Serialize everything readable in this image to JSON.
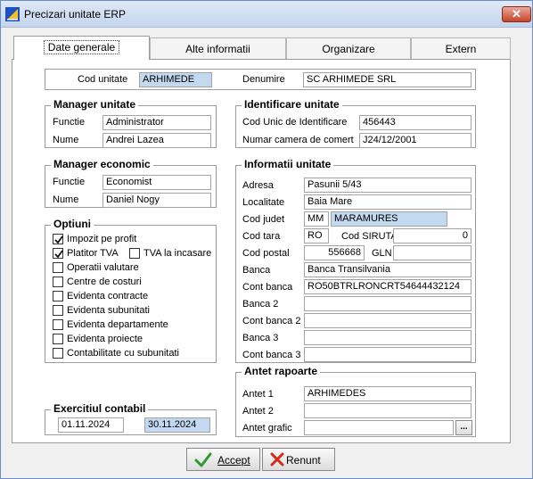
{
  "window": {
    "title": "Precizari unitate ERP",
    "close_label": "✕"
  },
  "tabs": [
    {
      "label": "Date generale"
    },
    {
      "label": "Alte informatii"
    },
    {
      "label": "Organizare"
    },
    {
      "label": "Extern"
    }
  ],
  "header": {
    "cod_unitate_label": "Cod unitate",
    "cod_unitate_value": "ARHIMEDE",
    "denumire_label": "Denumire",
    "denumire_value": "SC ARHIMEDE SRL"
  },
  "manager_unitate": {
    "title": "Manager unitate",
    "functie_label": "Functie",
    "functie_value": "Administrator",
    "nume_label": "Nume",
    "nume_value": "Andrei Lazea"
  },
  "manager_economic": {
    "title": "Manager economic",
    "functie_label": "Functie",
    "functie_value": "Economist",
    "nume_label": "Nume",
    "nume_value": "Daniel Nogy"
  },
  "optiuni": {
    "title": "Optiuni",
    "items": [
      {
        "label": "Impozit pe profit",
        "checked": true
      },
      {
        "label": "Platitor TVA",
        "checked": true
      },
      {
        "label": "TVA la incasare",
        "checked": false
      },
      {
        "label": "Operatii valutare",
        "checked": false
      },
      {
        "label": "Centre de costuri",
        "checked": false
      },
      {
        "label": "Evidenta contracte",
        "checked": false
      },
      {
        "label": "Evidenta subunitati",
        "checked": false
      },
      {
        "label": "Evidenta departamente",
        "checked": false
      },
      {
        "label": "Evidenta proiecte",
        "checked": false
      },
      {
        "label": "Contabilitate cu subunitati",
        "checked": false
      }
    ]
  },
  "exercitiu": {
    "title": "Exercitiul contabil",
    "start": "01.11.2024",
    "end": "30.11.2024"
  },
  "identificare": {
    "title": "Identificare unitate",
    "cui_label": "Cod Unic de Identificare",
    "cui_value": "456443",
    "reg_label": "Numar camera de comert",
    "reg_value": "J24/12/2001"
  },
  "informatii": {
    "title": "Informatii unitate",
    "adresa_label": "Adresa",
    "adresa_value": "Pasunii 5/43",
    "localitate_label": "Localitate",
    "localitate_value": "Baia Mare",
    "judet_label": "Cod judet",
    "judet_code": "MM",
    "judet_name": "MARAMURES",
    "tara_label": "Cod tara",
    "tara_value": "RO",
    "siruta_label": "Cod SIRUTA",
    "siruta_value": "0",
    "postal_label": "Cod postal",
    "postal_value": "556668",
    "gln_label": "GLN",
    "gln_value": "",
    "banca_label": "Banca",
    "banca_value": "Banca Transilvania",
    "cont_label": "Cont banca",
    "cont_value": "RO50BTRLRONCRT54644432124",
    "banca2_label": "Banca 2",
    "banca2_value": "",
    "cont2_label": "Cont banca 2",
    "cont2_value": "",
    "banca3_label": "Banca 3",
    "banca3_value": "",
    "cont3_label": "Cont banca 3",
    "cont3_value": ""
  },
  "antet": {
    "title": "Antet rapoarte",
    "antet1_label": "Antet 1",
    "antet1_value": "ARHIMEDES",
    "antet2_label": "Antet 2",
    "antet2_value": "",
    "grafic_label": "Antet grafic",
    "grafic_value": "",
    "browse_label": "..."
  },
  "buttons": {
    "accept": "Accept",
    "renunt": "Renunt"
  },
  "colors": {
    "selected_field": "#c3d9f0",
    "accept_icon": "#2e9a2e",
    "renunt_icon": "#d42a1a"
  }
}
